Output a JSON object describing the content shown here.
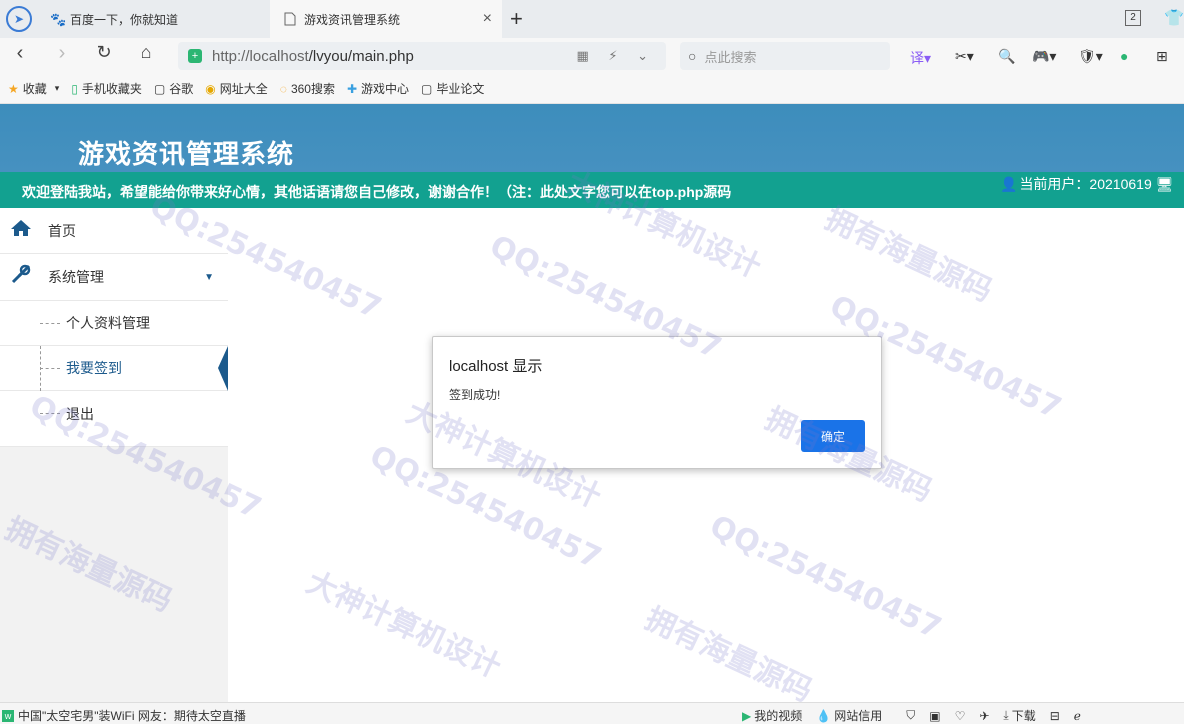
{
  "browser": {
    "tabs": [
      {
        "label": "百度一下，你就知道"
      },
      {
        "label": "游戏资讯管理系统"
      }
    ],
    "tab_count": "2",
    "url_host": "http://localhost",
    "url_path": "/lvyou/main.php",
    "search_placeholder": "点此搜索",
    "bookmarks": [
      {
        "label": "收藏",
        "icon": "star-icon"
      },
      {
        "label": "手机收藏夹",
        "icon": "phone-icon"
      },
      {
        "label": "谷歌",
        "icon": "page-icon"
      },
      {
        "label": "网址大全",
        "icon": "globe-icon"
      },
      {
        "label": "360搜索",
        "icon": "search-360-icon"
      },
      {
        "label": "游戏中心",
        "icon": "gamepad-icon"
      },
      {
        "label": "毕业论文",
        "icon": "page-icon"
      }
    ]
  },
  "header": {
    "title": "游戏资讯管理系统",
    "welcome": "欢迎登陆我站，希望能给你带来好心情，其他话语请您自己修改，谢谢合作！（注：此处文字您可以在top.php源码",
    "user_label": "当前用户：20210619"
  },
  "sidebar": {
    "home": "首页",
    "system": "系统管理",
    "subitems": [
      {
        "label": "个人资料管理"
      },
      {
        "label": "我要签到"
      },
      {
        "label": "退出"
      }
    ]
  },
  "dialog": {
    "title": "localhost 显示",
    "message": "签到成功!",
    "ok_label": "确定"
  },
  "statusbar": {
    "news": "中国\"太空宅男\"装WiFi 网友：期待太空直播",
    "items": [
      {
        "label": "我的视频"
      },
      {
        "label": "网站信用"
      },
      {
        "label": "下载"
      }
    ]
  },
  "watermark": {
    "qq": "QQ:254540457",
    "line1": "大神计算机设计",
    "line2": "拥有海量源码"
  },
  "colors": {
    "header_blue": "#3d8dbc",
    "subbar_teal": "#12a190",
    "accent_blue": "#1a73e8",
    "sidebar_icon": "#1c5a8c"
  }
}
